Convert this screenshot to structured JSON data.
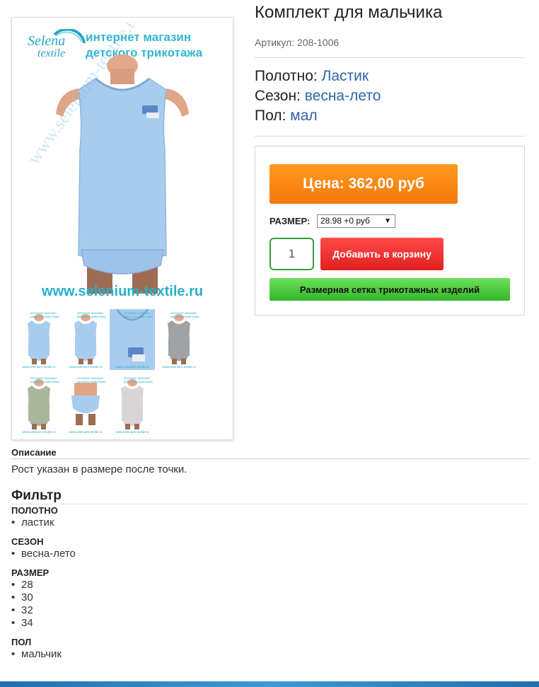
{
  "product": {
    "title": "Комплект для мальчика",
    "sku": "Артикул: 208-1006",
    "attributes": [
      {
        "key": "Полотно:",
        "value": "Ластик"
      },
      {
        "key": "Сезон:",
        "value": "весна-лето"
      },
      {
        "key": "Пол:",
        "value": "мал"
      }
    ]
  },
  "gallery": {
    "brand_script_1": "Selena",
    "brand_script_2": "textile",
    "brand_line_1": "интернет магазин",
    "brand_line_2": "детского трикотажа",
    "watermark": "www.selenium-textile.ru",
    "url": "www.selenium-textile.ru",
    "thumb_brand_1": "интернет магазин",
    "thumb_brand_2": "детского трикотажа",
    "thumb_url": "www.selenium-textile.ru"
  },
  "buy": {
    "price_label": "Цена: 362,00 руб",
    "size_label": "РАЗМЕР:",
    "size_selected": "28.98 +0 руб",
    "quantity": "1",
    "add_to_cart": "Добавить в корзину",
    "size_chart": "Размерная сетка трикотажных изделий"
  },
  "description": {
    "heading": "Описание",
    "text": "Рост указан в размере после точки."
  },
  "filter": {
    "heading": "Фильтр",
    "groups": [
      {
        "title": "ПОЛОТНО",
        "items": [
          "ластик"
        ]
      },
      {
        "title": "СЕЗОН",
        "items": [
          "весна-лето"
        ]
      },
      {
        "title": "РАЗМЕР",
        "items": [
          "28",
          "30",
          "32",
          "34"
        ]
      },
      {
        "title": "ПОЛ",
        "items": [
          "мальчик"
        ]
      }
    ]
  },
  "colors": {
    "price_orange": "#f4770a",
    "cart_red": "#e21f1f",
    "chart_green": "#33b52a",
    "link_blue": "#2e64a8"
  }
}
